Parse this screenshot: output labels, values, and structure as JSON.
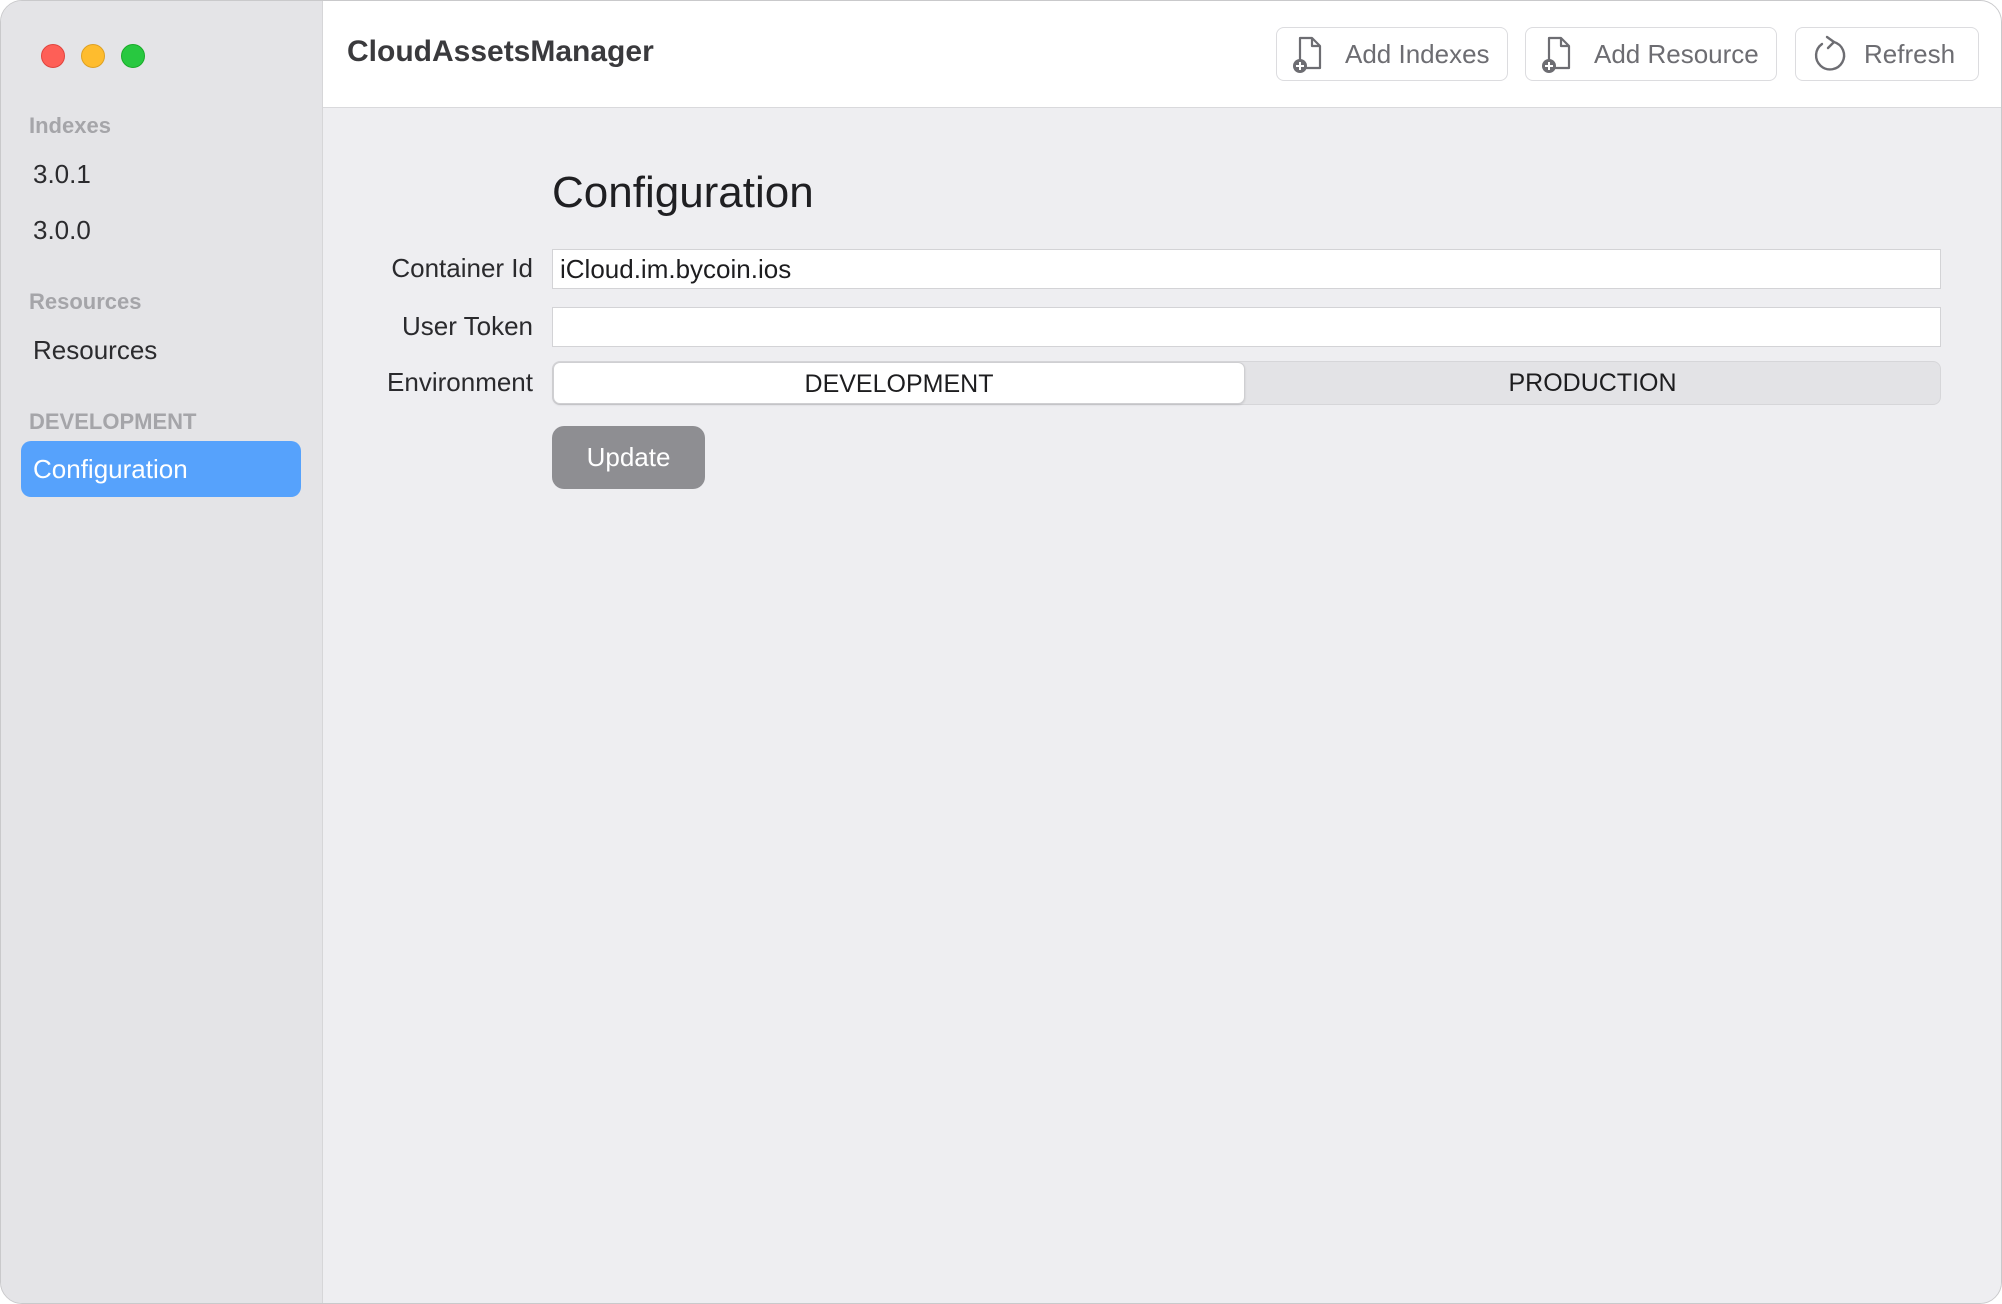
{
  "app": {
    "title": "CloudAssetsManager"
  },
  "toolbar": {
    "add_indexes_label": "Add Indexes",
    "add_resource_label": "Add Resource",
    "refresh_label": "Refresh"
  },
  "sidebar": {
    "sections": [
      {
        "header": "Indexes",
        "items": [
          {
            "label": "3.0.1"
          },
          {
            "label": "3.0.0"
          }
        ]
      },
      {
        "header": "Resources",
        "items": [
          {
            "label": "Resources"
          }
        ]
      },
      {
        "header": "DEVELOPMENT",
        "items": [
          {
            "label": "Configuration",
            "selected": true
          }
        ]
      }
    ]
  },
  "main": {
    "title": "Configuration",
    "container_id": {
      "label": "Container Id",
      "value": "iCloud.im.bycoin.ios"
    },
    "user_token": {
      "label": "User Token",
      "value": ""
    },
    "environment": {
      "label": "Environment",
      "options": [
        "DEVELOPMENT",
        "PRODUCTION"
      ],
      "selected": "DEVELOPMENT"
    },
    "update_label": "Update"
  },
  "colors": {
    "accent": "#56a2fc",
    "sidebar_bg": "#e4e4e7",
    "content_bg": "#eeeef1",
    "update_button": "#8e8e92",
    "close": "#fe5f57",
    "minimize": "#febc2e",
    "zoom": "#28c840"
  },
  "icons": {
    "add_indexes": "doc-plus-icon",
    "add_resource": "doc-plus-icon",
    "refresh": "refresh-icon"
  }
}
